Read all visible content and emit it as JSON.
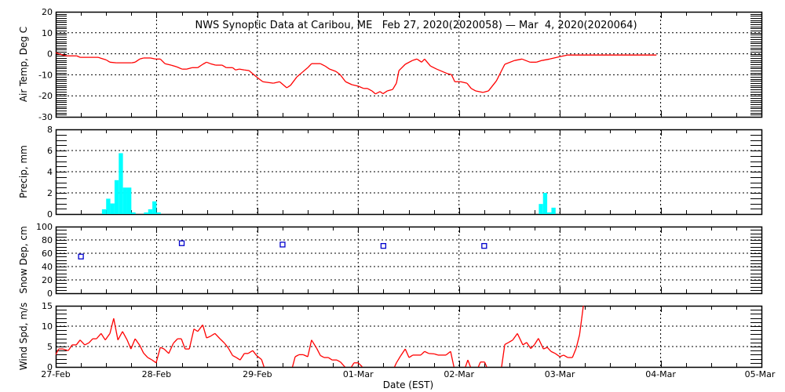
{
  "title": "NWS Synoptic Data at Caribou, ME   Feb 27, 2020(2020058) — Mar  4, 2020(2020064)",
  "xlabel": "Date (EST)",
  "x_tick_labels": [
    "27-Feb",
    "28-Feb",
    "29-Feb",
    "01-Mar",
    "02-Mar",
    "03-Mar",
    "04-Mar",
    "05-Mar"
  ],
  "colors": {
    "temp": "#ff0000",
    "precip": "#00ffff",
    "snow": "#0000cc",
    "wind": "#ff0000"
  },
  "chart_data": [
    {
      "type": "line",
      "name": "temp",
      "ylabel": "Air Temp, Deg C",
      "x_units": "hours since 27-Feb 00:00 EST",
      "xlim": [
        0,
        168
      ],
      "ylim": [
        -30,
        20
      ],
      "yticks": [
        20,
        10,
        0,
        -10,
        -20,
        -30
      ],
      "grid": true,
      "points": [
        [
          0,
          0.5
        ],
        [
          1.7,
          -0.6
        ],
        [
          2.6,
          -1
        ],
        [
          5.0,
          -1
        ],
        [
          5.8,
          -1.7
        ],
        [
          10.1,
          -1.7
        ],
        [
          12.0,
          -2.9
        ],
        [
          12.9,
          -4
        ],
        [
          14.4,
          -4.3
        ],
        [
          18.1,
          -4.3
        ],
        [
          18.9,
          -4
        ],
        [
          20.0,
          -2.5
        ],
        [
          20.9,
          -2
        ],
        [
          22.6,
          -2
        ],
        [
          23.7,
          -2.5
        ],
        [
          24.9,
          -2.5
        ],
        [
          26.0,
          -4.7
        ],
        [
          27.5,
          -5.4
        ],
        [
          28.8,
          -6.2
        ],
        [
          30.1,
          -7.3
        ],
        [
          31.2,
          -7.3
        ],
        [
          32.5,
          -6.6
        ],
        [
          33.8,
          -6.6
        ],
        [
          35.0,
          -5
        ],
        [
          35.9,
          -4
        ],
        [
          36.8,
          -4.7
        ],
        [
          38.1,
          -5.4
        ],
        [
          39.6,
          -5.4
        ],
        [
          40.6,
          -6.6
        ],
        [
          42.1,
          -6.6
        ],
        [
          42.8,
          -7.7
        ],
        [
          43.7,
          -7.3
        ],
        [
          44.9,
          -7.7
        ],
        [
          46.0,
          -8
        ],
        [
          47.8,
          -11
        ],
        [
          49.3,
          -13.3
        ],
        [
          51.8,
          -14
        ],
        [
          53.3,
          -13.3
        ],
        [
          55.0,
          -16.2
        ],
        [
          55.9,
          -15
        ],
        [
          57.4,
          -11
        ],
        [
          58.7,
          -8.8
        ],
        [
          60.0,
          -6.6
        ],
        [
          60.9,
          -4.7
        ],
        [
          63.0,
          -4.7
        ],
        [
          64.1,
          -5.8
        ],
        [
          65.2,
          -7.3
        ],
        [
          66.7,
          -8.4
        ],
        [
          67.7,
          -9.9
        ],
        [
          69.0,
          -13.3
        ],
        [
          70.5,
          -14.7
        ],
        [
          72.0,
          -15.4
        ],
        [
          73.3,
          -16.5
        ],
        [
          74.2,
          -16.5
        ],
        [
          75.3,
          -17.7
        ],
        [
          76.1,
          -19.1
        ],
        [
          77.2,
          -18
        ],
        [
          77.9,
          -19
        ],
        [
          78.9,
          -17.7
        ],
        [
          80.2,
          -17
        ],
        [
          81.1,
          -14
        ],
        [
          81.7,
          -8
        ],
        [
          83.2,
          -5
        ],
        [
          84.9,
          -3.2
        ],
        [
          86.0,
          -2.5
        ],
        [
          87.1,
          -4
        ],
        [
          87.8,
          -2.5
        ],
        [
          89.2,
          -5.8
        ],
        [
          90.7,
          -7.3
        ],
        [
          93.3,
          -9.5
        ],
        [
          94.2,
          -9.9
        ],
        [
          95.0,
          -13.3
        ],
        [
          96.4,
          -13.3
        ],
        [
          97.9,
          -14
        ],
        [
          98.9,
          -16.5
        ],
        [
          100.0,
          -17.7
        ],
        [
          101.7,
          -18.4
        ],
        [
          103.0,
          -17.7
        ],
        [
          104.9,
          -12.9
        ],
        [
          106.9,
          -5
        ],
        [
          109.2,
          -3.2
        ],
        [
          111.0,
          -2.5
        ],
        [
          112.9,
          -4
        ],
        [
          114.4,
          -4
        ],
        [
          115.7,
          -3.2
        ],
        [
          117.6,
          -2.5
        ],
        [
          119.9,
          -1.4
        ],
        [
          121.8,
          -0.6
        ],
        [
          143.0,
          -0.6
        ]
      ]
    },
    {
      "type": "bar",
      "name": "precip",
      "ylabel": "Precip, mm",
      "x_units": "hour bins since 27-Feb 00:00 EST",
      "xlim": [
        0,
        168
      ],
      "ylim": [
        0,
        8
      ],
      "yticks": [
        0,
        2,
        4,
        6,
        8
      ],
      "grid": true,
      "bars": [
        [
          11,
          0.45
        ],
        [
          12,
          1.45
        ],
        [
          13,
          1.0
        ],
        [
          14,
          3.2
        ],
        [
          15,
          5.75
        ],
        [
          16,
          2.5
        ],
        [
          17,
          2.5
        ],
        [
          18,
          0.15
        ],
        [
          21,
          0.15
        ],
        [
          22,
          0.45
        ],
        [
          23,
          1.2
        ],
        [
          24,
          0.15
        ],
        [
          115,
          0.95
        ],
        [
          116,
          2.0
        ],
        [
          117,
          0.15
        ],
        [
          118,
          0.6
        ]
      ]
    },
    {
      "type": "scatter",
      "name": "snow",
      "ylabel": "Snow Dep, cm",
      "x_units": "hours since 27-Feb 00:00 EST",
      "xlim": [
        0,
        168
      ],
      "ylim": [
        0,
        100
      ],
      "yticks": [
        0,
        20,
        40,
        60,
        80,
        100
      ],
      "grid": true,
      "points": [
        [
          6,
          55
        ],
        [
          30,
          75
        ],
        [
          54,
          73
        ],
        [
          78,
          71
        ],
        [
          102,
          71
        ]
      ]
    },
    {
      "type": "line",
      "name": "wind",
      "ylabel": "Wind Spd, m/s",
      "x_units": "hours since 27-Feb 00:00 EST",
      "xlim": [
        0,
        168
      ],
      "ylim": [
        0,
        15
      ],
      "yticks": [
        0,
        5,
        10,
        15
      ],
      "grid": true,
      "points": [
        [
          0,
          3.0
        ],
        [
          0.7,
          4.4
        ],
        [
          1.7,
          4.4
        ],
        [
          3.0,
          4.0
        ],
        [
          3.9,
          5.4
        ],
        [
          4.9,
          5.4
        ],
        [
          5.8,
          6.6
        ],
        [
          6.9,
          5.4
        ],
        [
          7.9,
          5.9
        ],
        [
          8.8,
          6.9
        ],
        [
          9.7,
          6.9
        ],
        [
          10.8,
          8.2
        ],
        [
          11.8,
          6.6
        ],
        [
          12.9,
          8.2
        ],
        [
          13.8,
          11.9
        ],
        [
          14.8,
          6.6
        ],
        [
          15.9,
          8.7
        ],
        [
          17.0,
          6.6
        ],
        [
          17.9,
          4.4
        ],
        [
          18.9,
          6.9
        ],
        [
          20.0,
          5.3
        ],
        [
          20.9,
          3.4
        ],
        [
          21.9,
          2.3
        ],
        [
          22.8,
          1.8
        ],
        [
          23.9,
          1.0
        ],
        [
          24.9,
          4.8
        ],
        [
          25.8,
          4.4
        ],
        [
          26.9,
          3.3
        ],
        [
          28.0,
          5.8
        ],
        [
          29.0,
          6.9
        ],
        [
          29.9,
          6.9
        ],
        [
          30.8,
          4.4
        ],
        [
          31.8,
          4.4
        ],
        [
          32.9,
          9.3
        ],
        [
          33.8,
          8.7
        ],
        [
          35.0,
          10.3
        ],
        [
          35.9,
          7.1
        ],
        [
          36.8,
          7.5
        ],
        [
          37.9,
          8.2
        ],
        [
          39.1,
          6.9
        ],
        [
          40.2,
          5.8
        ],
        [
          41.1,
          4.6
        ],
        [
          42.1,
          2.8
        ],
        [
          43.0,
          2.3
        ],
        [
          43.9,
          1.7
        ],
        [
          44.9,
          3.3
        ],
        [
          45.8,
          3.3
        ],
        [
          46.9,
          4.0
        ],
        [
          47.8,
          2.8
        ],
        [
          49.0,
          1.8
        ],
        [
          49.9,
          -1
        ],
        [
          56.1,
          -1
        ],
        [
          57.0,
          2.5
        ],
        [
          57.9,
          3.0
        ],
        [
          58.9,
          3.0
        ],
        [
          60.0,
          2.5
        ],
        [
          60.9,
          6.6
        ],
        [
          62.1,
          4.6
        ],
        [
          63.0,
          2.8
        ],
        [
          63.9,
          2.3
        ],
        [
          64.9,
          2.3
        ],
        [
          65.8,
          1.7
        ],
        [
          66.9,
          1.7
        ],
        [
          67.8,
          1.2
        ],
        [
          69.0,
          -0.2
        ],
        [
          70.1,
          -0.5
        ],
        [
          71.0,
          1.0
        ],
        [
          72.0,
          1.0
        ],
        [
          72.9,
          0.1
        ],
        [
          73.3,
          -1
        ],
        [
          80.2,
          -1
        ],
        [
          81.1,
          1.0
        ],
        [
          82.1,
          2.7
        ],
        [
          83.2,
          4.4
        ],
        [
          84.1,
          2.3
        ],
        [
          85.0,
          2.9
        ],
        [
          86.9,
          2.9
        ],
        [
          87.8,
          3.8
        ],
        [
          88.8,
          3.3
        ],
        [
          90.1,
          3.2
        ],
        [
          91.0,
          2.9
        ],
        [
          92.9,
          2.9
        ],
        [
          94.0,
          3.8
        ],
        [
          95.0,
          -1
        ],
        [
          97.2,
          -1
        ],
        [
          98.1,
          1.7
        ],
        [
          99.1,
          -1
        ],
        [
          100.2,
          -1
        ],
        [
          101.1,
          1.2
        ],
        [
          102.1,
          1.2
        ],
        [
          103.0,
          -1
        ],
        [
          106.0,
          -1
        ],
        [
          106.9,
          5.5
        ],
        [
          107.8,
          6.0
        ],
        [
          108.8,
          6.6
        ],
        [
          109.9,
          8.2
        ],
        [
          111.2,
          5.4
        ],
        [
          112.1,
          6.0
        ],
        [
          113.1,
          4.5
        ],
        [
          114.0,
          5.5
        ],
        [
          114.9,
          7.0
        ],
        [
          116.1,
          4.4
        ],
        [
          117.0,
          4.8
        ],
        [
          117.9,
          3.8
        ],
        [
          118.9,
          3.3
        ],
        [
          120.0,
          2.5
        ],
        [
          120.9,
          2.9
        ],
        [
          121.9,
          2.3
        ],
        [
          123.0,
          2.3
        ],
        [
          123.9,
          4.6
        ],
        [
          124.7,
          7.9
        ],
        [
          125.2,
          11.8
        ],
        [
          125.6,
          15
        ],
        [
          126.0,
          18
        ]
      ]
    }
  ]
}
